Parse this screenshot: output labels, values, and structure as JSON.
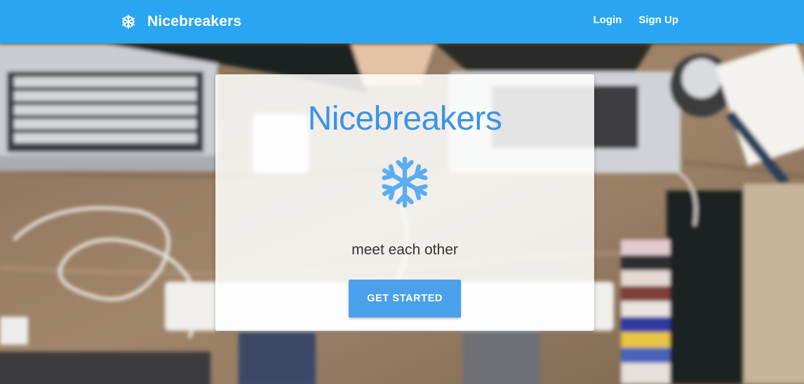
{
  "navbar": {
    "brand": "Nicebreakers",
    "brand_icon": "snowflake-icon",
    "links": [
      {
        "label": "Login"
      },
      {
        "label": "Sign Up"
      }
    ],
    "color": "#2aa5f1"
  },
  "hero": {
    "background": "blurred photo of fist bump over desk with laptops"
  },
  "card": {
    "title": "Nicebreakers",
    "icon": "snowflake-icon",
    "tagline": "meet each other",
    "cta_label": "GET STARTED",
    "accent": "#3a94e6"
  }
}
